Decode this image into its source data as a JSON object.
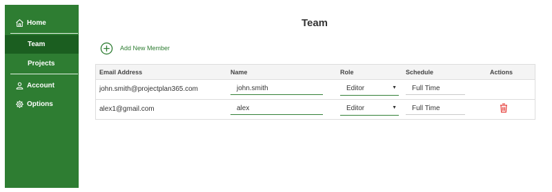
{
  "sidebar": {
    "items": [
      {
        "label": "Home",
        "icon": "home-icon"
      },
      {
        "label": "Team"
      },
      {
        "label": "Projects"
      },
      {
        "label": "Account",
        "icon": "user-icon"
      },
      {
        "label": "Options",
        "icon": "gear-icon"
      }
    ],
    "active": "Team",
    "colors": {
      "background": "#2e7d32",
      "active_background": "#1b5e20"
    }
  },
  "main": {
    "title": "Team",
    "add_member_label": "Add New Member",
    "table": {
      "columns": [
        "Email Address",
        "Name",
        "Role",
        "Schedule",
        "Actions"
      ],
      "rows": [
        {
          "email": "john.smith@projectplan365.com",
          "name": "john.smith",
          "role": "Editor",
          "schedule": "Full Time",
          "has_delete": false
        },
        {
          "email": "alex1@gmail.com",
          "name": "alex",
          "role": "Editor",
          "schedule": "Full Time",
          "has_delete": true
        }
      ]
    },
    "colors": {
      "accent": "#2e7d32",
      "delete": "#e53935"
    }
  }
}
